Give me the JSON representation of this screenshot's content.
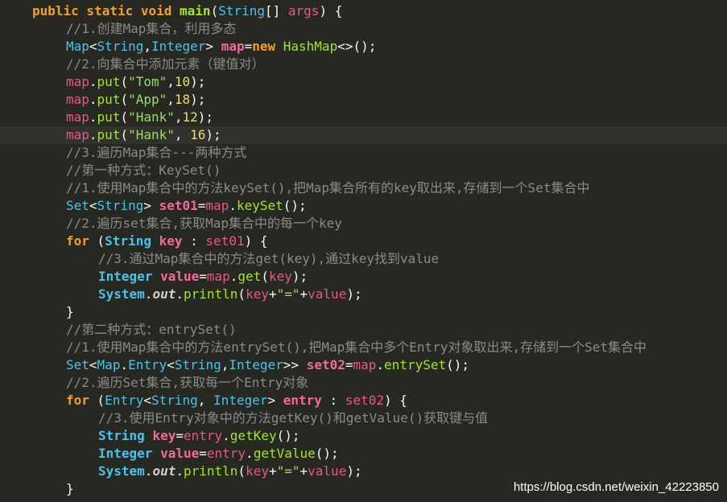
{
  "editor": {
    "theme_bg": "#272822",
    "highlight_bg": "#31322b",
    "lines": [
      {
        "highlight": false,
        "indent": 40,
        "tokens": [
          {
            "t": "public static void ",
            "c": "kw"
          },
          {
            "t": "main",
            "c": "fnb"
          },
          {
            "t": "(",
            "c": "pl"
          },
          {
            "t": "String",
            "c": "type"
          },
          {
            "t": "[] ",
            "c": "pl"
          },
          {
            "t": "args",
            "c": "var"
          },
          {
            "t": ") {",
            "c": "pl"
          }
        ]
      },
      {
        "highlight": false,
        "indent": 82,
        "tokens": [
          {
            "t": "//1.创建Map集合，利用多态",
            "c": "cm"
          }
        ]
      },
      {
        "highlight": false,
        "indent": 82,
        "tokens": [
          {
            "t": "Map",
            "c": "type"
          },
          {
            "t": "<",
            "c": "pl"
          },
          {
            "t": "String",
            "c": "type"
          },
          {
            "t": ",",
            "c": "pl"
          },
          {
            "t": "Integer",
            "c": "type"
          },
          {
            "t": "> ",
            "c": "pl"
          },
          {
            "t": "map",
            "c": "varb"
          },
          {
            "t": "=",
            "c": "pl"
          },
          {
            "t": "new ",
            "c": "kw"
          },
          {
            "t": "HashMap",
            "c": "fn"
          },
          {
            "t": "<>();",
            "c": "pl"
          }
        ]
      },
      {
        "highlight": false,
        "indent": 82,
        "tokens": [
          {
            "t": "//2.向集合中添加元素（键值对）",
            "c": "cm"
          }
        ]
      },
      {
        "highlight": false,
        "indent": 82,
        "tokens": [
          {
            "t": "map",
            "c": "var"
          },
          {
            "t": ".",
            "c": "pl"
          },
          {
            "t": "put",
            "c": "fn"
          },
          {
            "t": "(",
            "c": "pl"
          },
          {
            "t": "\"Tom\"",
            "c": "str"
          },
          {
            "t": ",",
            "c": "pl"
          },
          {
            "t": "10",
            "c": "num"
          },
          {
            "t": ");",
            "c": "pl"
          }
        ]
      },
      {
        "highlight": false,
        "indent": 82,
        "tokens": [
          {
            "t": "map",
            "c": "var"
          },
          {
            "t": ".",
            "c": "pl"
          },
          {
            "t": "put",
            "c": "fn"
          },
          {
            "t": "(",
            "c": "pl"
          },
          {
            "t": "\"App\"",
            "c": "str"
          },
          {
            "t": ",",
            "c": "pl"
          },
          {
            "t": "18",
            "c": "num"
          },
          {
            "t": ");",
            "c": "pl"
          }
        ]
      },
      {
        "highlight": false,
        "indent": 82,
        "tokens": [
          {
            "t": "map",
            "c": "var"
          },
          {
            "t": ".",
            "c": "pl"
          },
          {
            "t": "put",
            "c": "fn"
          },
          {
            "t": "(",
            "c": "pl"
          },
          {
            "t": "\"Hank\"",
            "c": "str"
          },
          {
            "t": ",",
            "c": "pl"
          },
          {
            "t": "12",
            "c": "num"
          },
          {
            "t": ");",
            "c": "pl"
          }
        ]
      },
      {
        "highlight": true,
        "indent": 82,
        "tokens": [
          {
            "t": "map",
            "c": "var"
          },
          {
            "t": ".",
            "c": "pl"
          },
          {
            "t": "put",
            "c": "fn"
          },
          {
            "t": "(",
            "c": "pl"
          },
          {
            "t": "\"Hank\"",
            "c": "str"
          },
          {
            "t": ", ",
            "c": "pl"
          },
          {
            "t": "16",
            "c": "num"
          },
          {
            "t": ");",
            "c": "pl"
          }
        ]
      },
      {
        "highlight": false,
        "indent": 82,
        "tokens": [
          {
            "t": "//3.遍历Map集合---两种方式",
            "c": "cm"
          }
        ]
      },
      {
        "highlight": false,
        "indent": 82,
        "tokens": [
          {
            "t": "//第一种方式：KeySet()",
            "c": "cm"
          }
        ]
      },
      {
        "highlight": false,
        "indent": 82,
        "tokens": [
          {
            "t": "//1.使用Map集合中的方法keySet(),把Map集合所有的key取出来,存储到一个Set集合中",
            "c": "cm"
          }
        ]
      },
      {
        "highlight": false,
        "indent": 82,
        "tokens": [
          {
            "t": "Set",
            "c": "type"
          },
          {
            "t": "<",
            "c": "pl"
          },
          {
            "t": "String",
            "c": "type"
          },
          {
            "t": "> ",
            "c": "pl"
          },
          {
            "t": "set01",
            "c": "varb"
          },
          {
            "t": "=",
            "c": "pl"
          },
          {
            "t": "map",
            "c": "var"
          },
          {
            "t": ".",
            "c": "pl"
          },
          {
            "t": "keySet",
            "c": "fn"
          },
          {
            "t": "();",
            "c": "pl"
          }
        ]
      },
      {
        "highlight": false,
        "indent": 82,
        "tokens": [
          {
            "t": "//2.遍历set集合,获取Map集合中的每一个key",
            "c": "cm"
          }
        ]
      },
      {
        "highlight": false,
        "indent": 82,
        "tokens": [
          {
            "t": "for ",
            "c": "kw"
          },
          {
            "t": "(",
            "c": "pl"
          },
          {
            "t": "String ",
            "c": "typeb"
          },
          {
            "t": "key",
            "c": "varb"
          },
          {
            "t": " : ",
            "c": "pl"
          },
          {
            "t": "set01",
            "c": "var"
          },
          {
            "t": ") {",
            "c": "pl"
          }
        ]
      },
      {
        "highlight": false,
        "indent": 122,
        "tokens": [
          {
            "t": "//3.通过Map集合中的方法get(key),通过key找到value",
            "c": "cm"
          }
        ]
      },
      {
        "highlight": false,
        "indent": 122,
        "tokens": [
          {
            "t": "Integer ",
            "c": "typeb"
          },
          {
            "t": "value",
            "c": "varb"
          },
          {
            "t": "=",
            "c": "pl"
          },
          {
            "t": "map",
            "c": "var"
          },
          {
            "t": ".",
            "c": "pl"
          },
          {
            "t": "get",
            "c": "fn"
          },
          {
            "t": "(",
            "c": "pl"
          },
          {
            "t": "key",
            "c": "var"
          },
          {
            "t": ");",
            "c": "pl"
          }
        ]
      },
      {
        "highlight": false,
        "indent": 122,
        "tokens": [
          {
            "t": "System",
            "c": "typeb"
          },
          {
            "t": ".",
            "c": "pl"
          },
          {
            "t": "out",
            "c": "out"
          },
          {
            "t": ".",
            "c": "pl"
          },
          {
            "t": "println",
            "c": "fn"
          },
          {
            "t": "(",
            "c": "pl"
          },
          {
            "t": "key",
            "c": "var"
          },
          {
            "t": "+",
            "c": "pl"
          },
          {
            "t": "\"=\"",
            "c": "str"
          },
          {
            "t": "+",
            "c": "pl"
          },
          {
            "t": "value",
            "c": "var"
          },
          {
            "t": ");",
            "c": "pl"
          }
        ]
      },
      {
        "highlight": false,
        "indent": 82,
        "tokens": [
          {
            "t": "}",
            "c": "pl"
          }
        ]
      },
      {
        "highlight": false,
        "indent": 82,
        "tokens": [
          {
            "t": "//第二种方式：entrySet()",
            "c": "cm"
          }
        ]
      },
      {
        "highlight": false,
        "indent": 82,
        "tokens": [
          {
            "t": "//1.使用Map集合中的方法entrySet(),把Map集合中多个Entry对象取出来,存储到一个Set集合中",
            "c": "cm"
          }
        ]
      },
      {
        "highlight": false,
        "indent": 82,
        "tokens": [
          {
            "t": "Set",
            "c": "type"
          },
          {
            "t": "<",
            "c": "pl"
          },
          {
            "t": "Map",
            "c": "type"
          },
          {
            "t": ".",
            "c": "pl"
          },
          {
            "t": "Entry",
            "c": "type"
          },
          {
            "t": "<",
            "c": "pl"
          },
          {
            "t": "String",
            "c": "type"
          },
          {
            "t": ",",
            "c": "pl"
          },
          {
            "t": "Integer",
            "c": "type"
          },
          {
            "t": ">> ",
            "c": "pl"
          },
          {
            "t": "set02",
            "c": "varb"
          },
          {
            "t": "=",
            "c": "pl"
          },
          {
            "t": "map",
            "c": "var"
          },
          {
            "t": ".",
            "c": "pl"
          },
          {
            "t": "entrySet",
            "c": "fn"
          },
          {
            "t": "();",
            "c": "pl"
          }
        ]
      },
      {
        "highlight": false,
        "indent": 82,
        "tokens": [
          {
            "t": "//2.遍历Set集合,获取每一个Entry对象",
            "c": "cm"
          }
        ]
      },
      {
        "highlight": false,
        "indent": 82,
        "tokens": [
          {
            "t": "for ",
            "c": "kw"
          },
          {
            "t": "(",
            "c": "pl"
          },
          {
            "t": "Entry",
            "c": "type"
          },
          {
            "t": "<",
            "c": "pl"
          },
          {
            "t": "String",
            "c": "type"
          },
          {
            "t": ", ",
            "c": "pl"
          },
          {
            "t": "Integer",
            "c": "type"
          },
          {
            "t": "> ",
            "c": "pl"
          },
          {
            "t": "entry",
            "c": "varb"
          },
          {
            "t": " : ",
            "c": "pl"
          },
          {
            "t": "set02",
            "c": "var"
          },
          {
            "t": ") {",
            "c": "pl"
          }
        ]
      },
      {
        "highlight": false,
        "indent": 122,
        "tokens": [
          {
            "t": "//3.使用Entry对象中的方法getKey()和getValue()获取键与值",
            "c": "cm"
          }
        ]
      },
      {
        "highlight": false,
        "indent": 122,
        "tokens": [
          {
            "t": "String ",
            "c": "typeb"
          },
          {
            "t": "key",
            "c": "varb"
          },
          {
            "t": "=",
            "c": "pl"
          },
          {
            "t": "entry",
            "c": "var"
          },
          {
            "t": ".",
            "c": "pl"
          },
          {
            "t": "getKey",
            "c": "fn"
          },
          {
            "t": "();",
            "c": "pl"
          }
        ]
      },
      {
        "highlight": false,
        "indent": 122,
        "tokens": [
          {
            "t": "Integer ",
            "c": "typeb"
          },
          {
            "t": "value",
            "c": "varb"
          },
          {
            "t": "=",
            "c": "pl"
          },
          {
            "t": "entry",
            "c": "var"
          },
          {
            "t": ".",
            "c": "pl"
          },
          {
            "t": "getValue",
            "c": "fn"
          },
          {
            "t": "();",
            "c": "pl"
          }
        ]
      },
      {
        "highlight": false,
        "indent": 122,
        "tokens": [
          {
            "t": "System",
            "c": "typeb"
          },
          {
            "t": ".",
            "c": "pl"
          },
          {
            "t": "out",
            "c": "out"
          },
          {
            "t": ".",
            "c": "pl"
          },
          {
            "t": "println",
            "c": "fn"
          },
          {
            "t": "(",
            "c": "pl"
          },
          {
            "t": "key",
            "c": "var"
          },
          {
            "t": "+",
            "c": "pl"
          },
          {
            "t": "\"=\"",
            "c": "str"
          },
          {
            "t": "+",
            "c": "pl"
          },
          {
            "t": "value",
            "c": "var"
          },
          {
            "t": ");",
            "c": "pl"
          }
        ]
      },
      {
        "highlight": false,
        "indent": 82,
        "tokens": [
          {
            "t": "}",
            "c": "pl"
          }
        ]
      }
    ]
  },
  "watermark": "https://blog.csdn.net/weixin_42223850"
}
